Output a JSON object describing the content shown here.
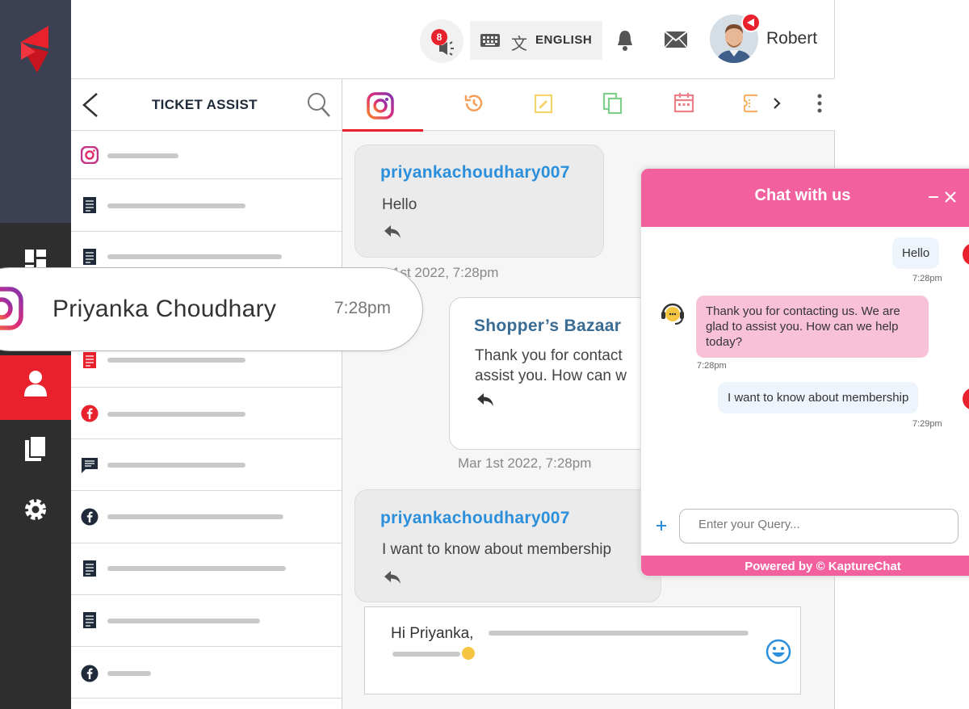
{
  "header": {
    "notification_count": "8",
    "language_label": "ENGLISH",
    "user_name": "Robert"
  },
  "ticket_list": {
    "title": "TICKET ASSIST",
    "rows": [
      "instagram",
      "document",
      "document",
      "document",
      "facebook",
      "chat",
      "facebook",
      "document",
      "document",
      "facebook"
    ]
  },
  "contact_card": {
    "name": "Priyanka Choudhary",
    "time": "7:28pm"
  },
  "conversation": {
    "messages": [
      {
        "sender": "priyankachoudhary007",
        "text": "Hello",
        "timestamp": "Mar 1st 2022, 7:28pm"
      },
      {
        "sender": "Shopper’s Bazaar",
        "text_line1": "Thank you for contact",
        "text_line2": "assist you. How can w",
        "timestamp": "Mar 1st 2022, 7:28pm"
      },
      {
        "sender": "priyankachoudhary007",
        "text": "I want to know about membership"
      }
    ],
    "reply_draft": "Hi Priyanka,"
  },
  "chat_widget": {
    "title": "Chat with us",
    "messages": [
      {
        "from": "user",
        "text": "Hello",
        "time": "7:28pm"
      },
      {
        "from": "agent",
        "text": "Thank you for contacting us. We are glad to assist you. How can we help today?",
        "time": "7:28pm"
      },
      {
        "from": "user",
        "text": "I want to know about membership",
        "time": "7:29pm"
      }
    ],
    "input_placeholder": "Enter your Query...",
    "footer": "Powered by © KaptureChat"
  },
  "colors": {
    "accent_red": "#e8212c",
    "link_blue": "#2b8fdc",
    "widget_pink": "#f2609e"
  }
}
